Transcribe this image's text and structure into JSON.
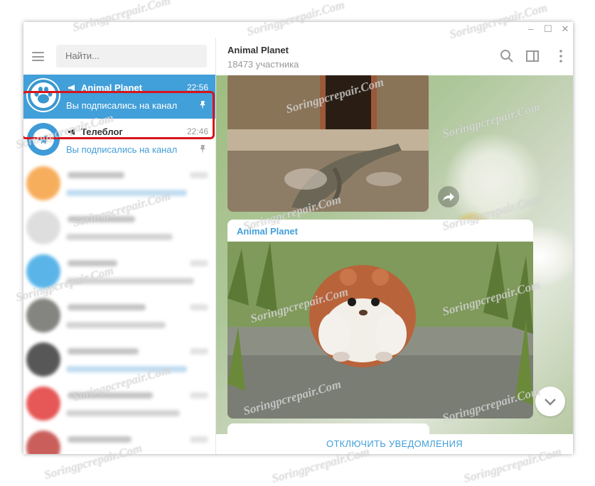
{
  "window": {
    "controls": [
      "–",
      "☐",
      "✕"
    ]
  },
  "sidebar": {
    "search_placeholder": "Найти...",
    "chats": [
      {
        "name": "Animal Planet",
        "time": "22:56",
        "preview": "Вы подписались на канал",
        "active": true,
        "pinned": true,
        "channel": true
      },
      {
        "name": "Телеблог",
        "time": "22:46",
        "preview": "Вы подписались на канал",
        "active": false,
        "pinned": true,
        "channel": true
      }
    ]
  },
  "header": {
    "title": "Animal Planet",
    "subtitle": "18473 участника"
  },
  "messages": [
    {
      "type": "photo",
      "description": "komodo-dragon-photo"
    },
    {
      "type": "photo",
      "author": "Animal Planet",
      "description": "hamster-photo"
    }
  ],
  "footer": {
    "mute_label": "ОТКЛЮЧИТЬ УВЕДОМЛЕНИЯ"
  },
  "watermark": "Soringpcrepair.Com",
  "colors": {
    "accent": "#419fd9",
    "highlight": "#d7151a"
  }
}
